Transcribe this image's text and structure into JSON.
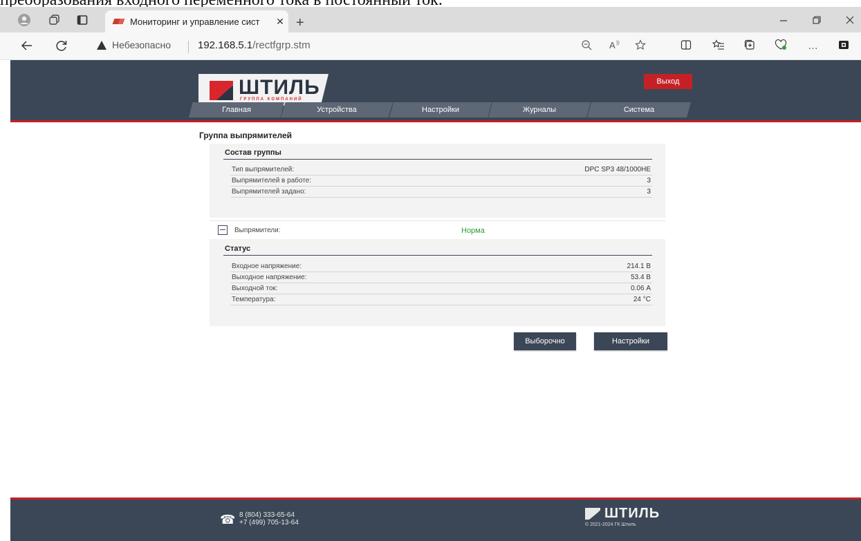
{
  "document_text": "преобразования входного переменного тока в постоянный ток.",
  "browser": {
    "tab_title": "Мониторинг и управление сист",
    "tab_close": "✕",
    "new_tab": "+",
    "security_label": "Небезопасно",
    "url_host": "192.168.5.1",
    "url_path": "/rectfgrp.stm",
    "icons": [
      "profile-icon",
      "workspaces-icon",
      "tab-actions-icon",
      "back-icon",
      "refresh-icon",
      "zoom-icon",
      "read-aloud-icon",
      "favorite-icon",
      "split-screen-icon",
      "favorites-icon",
      "collections-icon",
      "performance-icon",
      "more-icon",
      "extension-icon"
    ],
    "more": "…"
  },
  "site": {
    "logo_text": "ШТИЛЬ",
    "logo_sub": "ГРУППА КОМПАНИЙ",
    "logout": "Выход",
    "menu": [
      "Главная",
      "Устройства",
      "Настройки",
      "Журналы",
      "Система"
    ],
    "accent": "#c42127",
    "header_bg": "#3b4756"
  },
  "page": {
    "title": "Группа выпрямителей",
    "group": {
      "header": "Состав группы",
      "rows": [
        {
          "label": "Тип выпрямителей:",
          "value": "DPC SP3 48/1000HE"
        },
        {
          "label": "Выпрямителей в работе:",
          "value": "3"
        },
        {
          "label": "Выпрямителей задано:",
          "value": "3"
        }
      ]
    },
    "rectifiers": {
      "label": "Выпрямители:",
      "status": "Норма",
      "status_color": "#2e9a36"
    },
    "status": {
      "header": "Статус",
      "rows": [
        {
          "label": "Входное напряжение:",
          "value": "214.1 В"
        },
        {
          "label": "Выходное напряжение:",
          "value": "53.4 В"
        },
        {
          "label": "Выходной ток:",
          "value": "0.06 А"
        },
        {
          "label": "Температура:",
          "value": "24 °C"
        }
      ]
    },
    "buttons": {
      "selective": "Выборочно",
      "settings": "Настройки"
    }
  },
  "footer": {
    "phone1": "8 (804) 333-65-64",
    "phone2": "+7 (499) 705-13-64",
    "logo_text": "ШТИЛЬ",
    "copyright": "© 2021-2024 ГК Штиль"
  }
}
